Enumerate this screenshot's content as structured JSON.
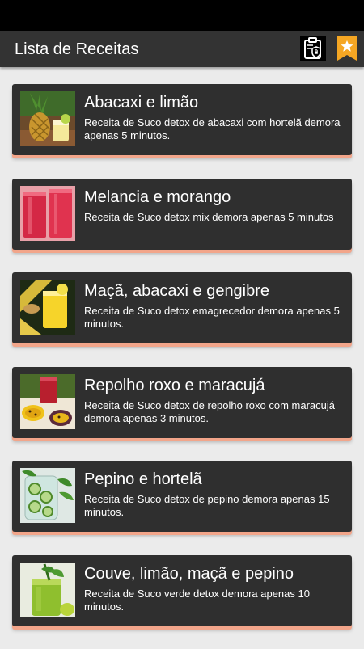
{
  "app_bar": {
    "title": "Lista de Receitas",
    "privacy_icon": "clipboard-shield-icon",
    "favorite_icon": "bookmark-star-icon"
  },
  "colors": {
    "app_bar": "#333333",
    "card": "#2f2f2f",
    "card_shadow_accent": "#f2a58a",
    "bookmark": "#f5a623",
    "background": "#ebebeb"
  },
  "recipes": [
    {
      "title": "Abacaxi e limão",
      "description": "Receita de Suco detox de abacaxi com hortelã demora apenas 5 minutos.",
      "image": "pineapple-lemon-juice"
    },
    {
      "title": "Melancia e morango",
      "description": "Receita de Suco detox mix demora apenas 5 minutos",
      "image": "watermelon-strawberry-juice"
    },
    {
      "title": "Maçã, abacaxi e gengibre",
      "description": "Receita de Suco detox emagrecedor demora apenas 5 minutos.",
      "image": "apple-pineapple-ginger-juice"
    },
    {
      "title": "Repolho roxo e maracujá",
      "description": "Receita de Suco detox de repolho roxo com maracujá demora apenas 3 minutos.",
      "image": "purple-cabbage-passionfruit-juice"
    },
    {
      "title": "Pepino e hortelã",
      "description": "Receita de Suco detox de pepino demora apenas 15 minutos.",
      "image": "cucumber-mint-water"
    },
    {
      "title": "Couve, limão, maçã e pepino",
      "description": "Receita de Suco verde detox demora apenas 10 minutos.",
      "image": "green-juice"
    }
  ]
}
